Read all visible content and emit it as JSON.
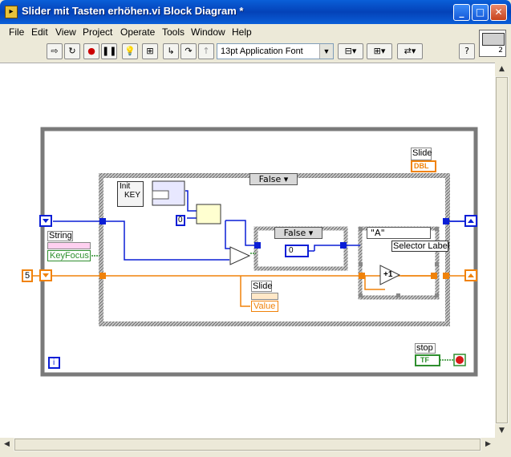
{
  "window": {
    "title": "Slider mit Tasten erhöhen.vi Block Diagram *"
  },
  "menu": [
    "File",
    "Edit",
    "View",
    "Project",
    "Operate",
    "Tools",
    "Window",
    "Help"
  ],
  "toolbar": {
    "font": "13pt Application Font",
    "help_label": "?"
  },
  "connector_pane": {
    "number": "2"
  },
  "diagram": {
    "slide_terminal": "Slide",
    "slide_type": "DBL",
    "case_outer": "False",
    "init_key_line1": "Init",
    "init_key_line2": "KEY",
    "string_label": "String",
    "keyfocus_label": "KeyFocus",
    "const_zero": "0",
    "case_inner": "False",
    "enum_zero": "0",
    "case_selector_value": "\"A\"",
    "selector_label": "Selector Label",
    "increment": "+1",
    "numeric_five": "5",
    "slide_prop_label": "Slide",
    "value_label": "Value",
    "stop_label": "stop",
    "stop_type": "TF",
    "iteration_label": "i",
    "question_mark": "?"
  },
  "colors": {
    "blue_wire": "#0a1ed6",
    "orange_wire": "#f0820a",
    "green_wire": "#2f8f2f",
    "loop_border": "#7a7a7a"
  }
}
